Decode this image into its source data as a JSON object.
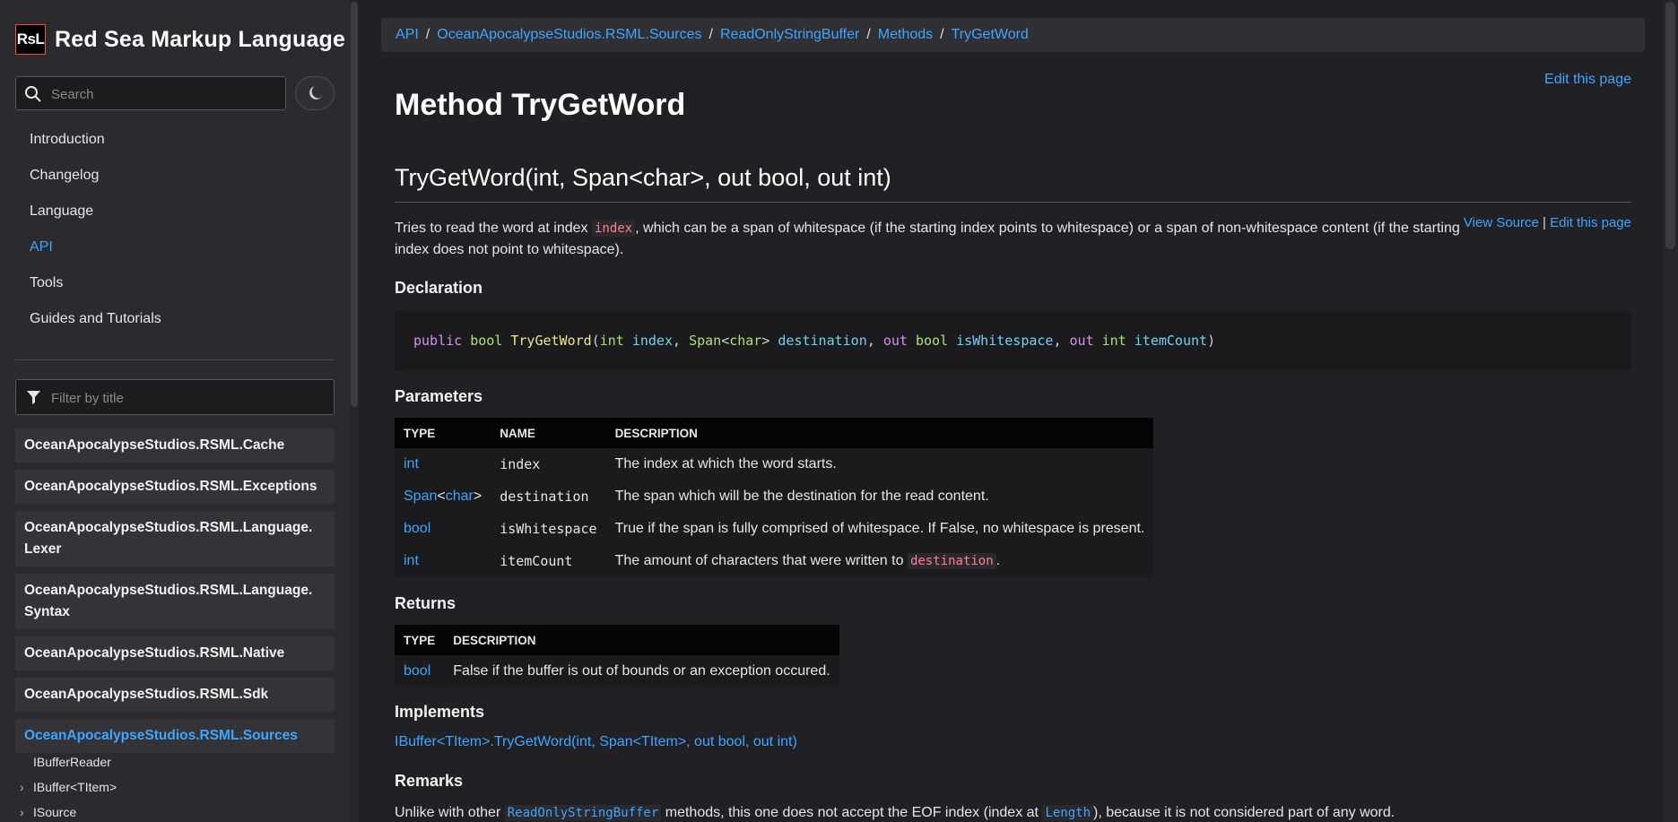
{
  "sidebar": {
    "logo_text": "RsL",
    "brand_title": "Red Sea Markup Language",
    "search_placeholder": "Search",
    "nav": [
      {
        "label": "Introduction"
      },
      {
        "label": "Changelog"
      },
      {
        "label": "Language"
      },
      {
        "label": "API",
        "active": true
      },
      {
        "label": "Tools"
      },
      {
        "label": "Guides and Tutorials"
      }
    ],
    "filter_placeholder": "Filter by title",
    "namespaces": [
      "OceanApocalypseStudios.RSML.Cache",
      "OceanApocalypseStudios.RSML.Exceptions",
      "OceanApocalypseStudios.RSML.Language.\nLexer",
      "OceanApocalypseStudios.RSML.Language.\nSyntax",
      "OceanApocalypseStudios.RSML.Native",
      "OceanApocalypseStudios.RSML.Sdk",
      "OceanApocalypseStudios.RSML.Sources"
    ],
    "active_namespace": "OceanApocalypseStudios.RSML.Sources",
    "sub_items": [
      {
        "label": "IBufferReader",
        "expandable": false
      },
      {
        "label": "IBuffer<TItem>",
        "expandable": true
      },
      {
        "label": "ISource",
        "expandable": true
      }
    ]
  },
  "breadcrumb": [
    "API",
    "OceanApocalypseStudios.RSML.Sources",
    "ReadOnlyStringBuffer",
    "Methods",
    "TryGetWord"
  ],
  "edit_page": "Edit this page",
  "title": "Method TryGetWord",
  "signature": "TryGetWord(int, Span<char>, out bool, out int)",
  "view_source": "View Source",
  "separator": "|",
  "summary": {
    "pre": "Tries to read the word at index ",
    "code": "index",
    "post": ", which can be a span of whitespace (if the starting index points to whitespace) or a span of non-whitespace content (if the starting index does not point to whitespace)."
  },
  "sections": {
    "declaration": "Declaration",
    "parameters": "Parameters",
    "returns": "Returns",
    "implements": "Implements",
    "remarks": "Remarks"
  },
  "declaration": [
    {
      "c": "k",
      "t": "public"
    },
    {
      "c": "",
      "t": " "
    },
    {
      "c": "t",
      "t": "bool"
    },
    {
      "c": "",
      "t": " "
    },
    {
      "c": "f",
      "t": "TryGetWord"
    },
    {
      "c": "pn",
      "t": "("
    },
    {
      "c": "t",
      "t": "int"
    },
    {
      "c": "",
      "t": " "
    },
    {
      "c": "p",
      "t": "index"
    },
    {
      "c": "pn",
      "t": ", "
    },
    {
      "c": "t",
      "t": "Span"
    },
    {
      "c": "pn",
      "t": "<"
    },
    {
      "c": "t",
      "t": "char"
    },
    {
      "c": "pn",
      "t": ">"
    },
    {
      "c": "",
      "t": " "
    },
    {
      "c": "p",
      "t": "destination"
    },
    {
      "c": "pn",
      "t": ", "
    },
    {
      "c": "k",
      "t": "out"
    },
    {
      "c": "",
      "t": " "
    },
    {
      "c": "t",
      "t": "bool"
    },
    {
      "c": "",
      "t": " "
    },
    {
      "c": "p",
      "t": "isWhitespace"
    },
    {
      "c": "pn",
      "t": ", "
    },
    {
      "c": "k",
      "t": "out"
    },
    {
      "c": "",
      "t": " "
    },
    {
      "c": "t",
      "t": "int"
    },
    {
      "c": "",
      "t": " "
    },
    {
      "c": "p",
      "t": "itemCount"
    },
    {
      "c": "pn",
      "t": ")"
    }
  ],
  "params_table": {
    "headers": [
      "TYPE",
      "NAME",
      "DESCRIPTION"
    ],
    "rows": [
      {
        "type": "int",
        "name": "index",
        "desc": "The index at which the word starts."
      },
      {
        "type": "Span<char>",
        "type_parts": [
          "Span",
          "<",
          "char",
          ">"
        ],
        "name": "destination",
        "desc": "The span which will be the destination for the read content."
      },
      {
        "type": "bool",
        "name": "isWhitespace",
        "desc": "True if the span is fully comprised of whitespace. If False, no whitespace is present."
      },
      {
        "type": "int",
        "name": "itemCount",
        "desc": "The amount of characters that were written to ",
        "desc_code": "destination",
        "desc_post": "."
      }
    ]
  },
  "returns_table": {
    "headers": [
      "TYPE",
      "DESCRIPTION"
    ],
    "rows": [
      {
        "type": "bool",
        "desc": "False if the buffer is out of bounds or an exception occured."
      }
    ]
  },
  "implements_link": "IBuffer<TItem>.TryGetWord(int, Span<TItem>, out bool, out int)",
  "remarks": {
    "pre": "Unlike with other ",
    "code1": "ReadOnlyStringBuffer",
    "mid": " methods, this one does not accept the EOF index (index at ",
    "code2": "Length",
    "post": "), because it is not considered part of any word."
  }
}
